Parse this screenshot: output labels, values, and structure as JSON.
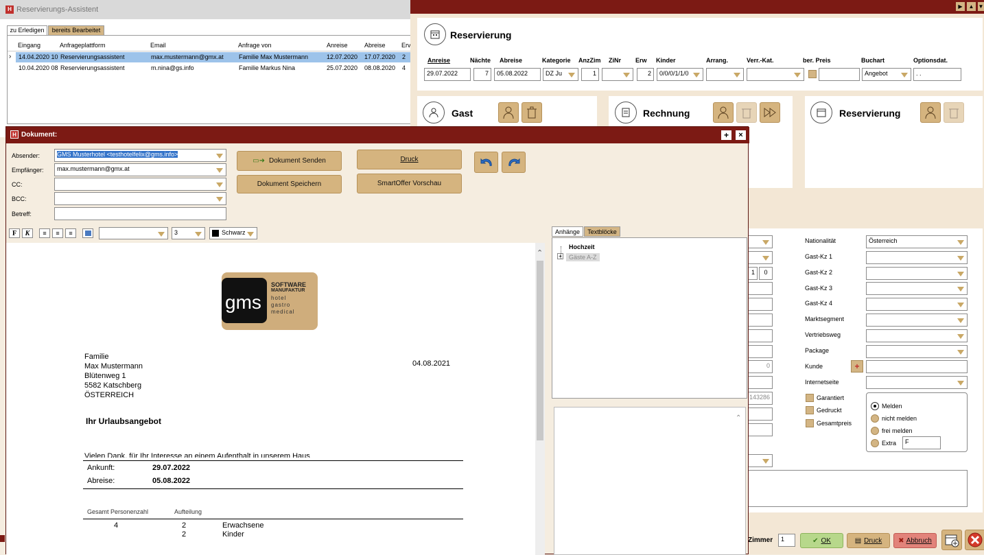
{
  "assistant": {
    "title": "Reservierungs-Assistent",
    "tabs": [
      "zu Erledigen",
      "bereits Bearbeitet"
    ],
    "columns": [
      "Eingang",
      "Anfrageplattform",
      "Email",
      "Anfrage von",
      "Anreise",
      "Abreise",
      "Erv"
    ],
    "rows": [
      {
        "eingang": "14.04.2020 10",
        "plattform": "Reservierungsassistent",
        "email": "max.mustermann@gmx.at",
        "von": "Familie  Max Mustermann",
        "anreise": "12.07.2020",
        "abreise": "17.07.2020",
        "erw": "2"
      },
      {
        "eingang": "10.04.2020 08",
        "plattform": "Reservierungsassistent",
        "email": "m.nina@gs.info",
        "von": "Familie  Markus Nina",
        "anreise": "25.07.2020",
        "abreise": "08.08.2020",
        "erw": "4"
      }
    ]
  },
  "reservation": {
    "title": "Reservierung",
    "labels": {
      "anreise": "Anreise",
      "naechte": "Nächte",
      "abreise": "Abreise",
      "kategorie": "Kategorie",
      "anzzim": "AnzZim",
      "zinr": "ZiNr",
      "erw": "Erw",
      "kinder": "Kinder",
      "arrang": "Arrang.",
      "verrkat": "Verr.-Kat.",
      "berpreis": "ber. Preis",
      "buchart": "Buchart",
      "optionsdat": "Optionsdat."
    },
    "values": {
      "anreise": "29.07.2022",
      "naechte": "7",
      "abreise": "05.08.2022",
      "kategorie": "DZ Ju",
      "anzzim": "1",
      "zinr": "",
      "erw": "2",
      "kinder": "0/0/0/1/1/0",
      "arrang": "",
      "verrkat": "",
      "berpreis": "",
      "buchart": "Angebot",
      "optionsdat": ". ."
    },
    "sections": {
      "gast": "Gast",
      "rechnung": "Rechnung",
      "reservierung": "Reservierung"
    }
  },
  "right_form": {
    "labels": [
      "Nationalität",
      "Gast-Kz 1",
      "Gast-Kz 2",
      "Gast-Kz 3",
      "Gast-Kz 4",
      "Marktsegment",
      "Vertriebsweg",
      "Package",
      "Kunde",
      "Internetseite"
    ],
    "nationalitaet_value": "Österreich",
    "left_values": {
      "num1": "1",
      "num2": "0",
      "field_0": "0",
      "field_id": "143286"
    },
    "checks": [
      "Garantiert",
      "Gedruckt",
      "Gesamtpreis"
    ],
    "radios": [
      "Melden",
      "nicht melden",
      "frei melden",
      "Extra"
    ],
    "extra_value": "F"
  },
  "bottom_bar": {
    "zimmer_label": "Zimmer",
    "zimmer_value": "1",
    "ok": "OK",
    "druck": "Druck",
    "abbruch": "Abbruch"
  },
  "dokument": {
    "title": "Dokument:",
    "labels": {
      "absender": "Absender:",
      "empfaenger": "Empfänger:",
      "cc": "CC:",
      "bcc": "BCC:",
      "betreff": "Betreff:"
    },
    "values": {
      "absender": "GMS Musterhotel <testhotelfelix@gms.info>",
      "empfaenger": "max.mustermann@gmx.at",
      "cc": "",
      "bcc": "",
      "betreff": ""
    },
    "buttons": {
      "senden": "Dokument Senden",
      "speichern": "Dokument Speichern",
      "druck": "Druck",
      "smartoffer": "SmartOffer Vorschau"
    },
    "toolbar": {
      "bold": "F",
      "italic": "K",
      "fontsize": "3",
      "color": "Schwarz"
    },
    "side_tabs": [
      "Anhänge",
      "Textblöcke"
    ],
    "tree": {
      "root": "Hochzeit",
      "child": "Gäste A-Z"
    }
  },
  "letter": {
    "logo": {
      "mark": "gms",
      "line1": "SOFTWARE",
      "line2": "MANUFAKTUR",
      "line3": "hotel",
      "line4": "gastro",
      "line5": "medical"
    },
    "address": [
      "Familie",
      "Max Mustermann",
      "Blütenweg 1",
      "5582 Katschberg",
      "ÖSTERREICH"
    ],
    "date": "04.08.2021",
    "heading": "Ihr Urlaubsangebot",
    "cut_text": "Vielen Dank, für Ihr Interesse an einem Aufenthalt in unserem Haus",
    "ankunft_label": "Ankunft:",
    "ankunft": "29.07.2022",
    "abreise_label": "Abreise:",
    "abreise": "05.08.2022",
    "persons_header": "Gesamt Personenzahl",
    "split_header": "Aufteilung",
    "persons_total": "4",
    "split": [
      {
        "count": "2",
        "label": "Erwachsene"
      },
      {
        "count": "2",
        "label": "Kinder"
      }
    ]
  }
}
